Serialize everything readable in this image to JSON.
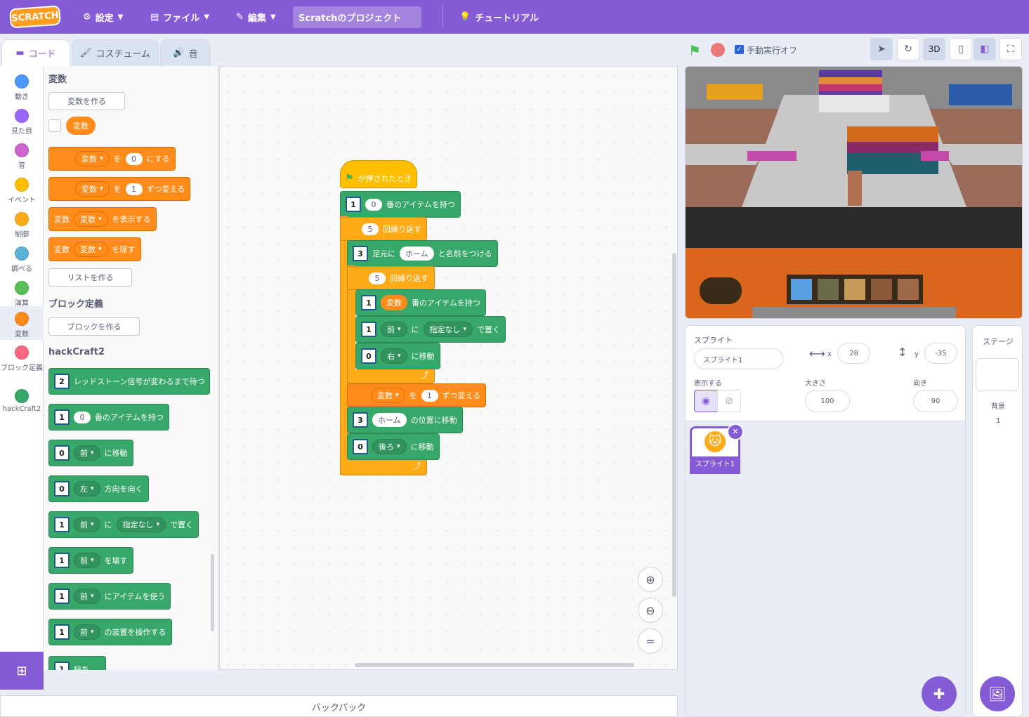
{
  "menubar": {
    "logo": "SCRATCH",
    "settings": "設定",
    "file": "ファイル",
    "edit": "編集",
    "project_title": "Scratchのプロジェクト",
    "tutorial": "チュートリアル"
  },
  "tabs": {
    "code": "コード",
    "costume": "コスチューム",
    "sound": "音"
  },
  "categories": [
    {
      "label": "動き",
      "color": "#4c97ff"
    },
    {
      "label": "見た目",
      "color": "#9966ff"
    },
    {
      "label": "音",
      "color": "#cf63cf"
    },
    {
      "label": "イベント",
      "color": "#ffbf00"
    },
    {
      "label": "制御",
      "color": "#ffab19"
    },
    {
      "label": "調べる",
      "color": "#5cb1d6"
    },
    {
      "label": "演算",
      "color": "#59c059"
    },
    {
      "label": "変数",
      "color": "#ff8c1a"
    },
    {
      "label": "ブロック定義",
      "color": "#ff6680"
    },
    {
      "label": "hackCraft2",
      "color": "#38a86a"
    }
  ],
  "flyout": {
    "variables_head": "変数",
    "make_var": "変数を作る",
    "var_name": "変数",
    "set_wo": "を",
    "set_val": "0",
    "set_suffix": "にする",
    "change_val": "1",
    "change_suffix": "ずつ変える",
    "show_suffix": "を表示する",
    "hide_suffix": "を隠す",
    "make_list": "リストを作る",
    "myblocks_head": "ブロック定義",
    "make_block": "ブロックを作る",
    "hc_head": "hackCraft2",
    "hc_wait": "レッドストーン信号が変わるまで待つ",
    "hc_hold_val": "0",
    "hc_hold": "番のアイテムを持つ",
    "front": "前",
    "left": "左",
    "move": "に移動",
    "face": "方向を向く",
    "ni": "に",
    "unspecified": "指定なし",
    "place": "で置く",
    "break": "を壊す",
    "use_item": "にアイテムを使う",
    "equip": "の装置を操作する",
    "cut": "持ち..."
  },
  "script": {
    "hat": "が押されたとき",
    "hold_val": "0",
    "hold": "番のアイテムを持つ",
    "repeat1": "5",
    "repeat_label": "回繰り返す",
    "name_prefix": "足元に",
    "name_val": "ホーム",
    "name_suffix": "と名前をつける",
    "repeat2": "5",
    "var": "変数",
    "front": "前",
    "ni": "に",
    "unspecified": "指定なし",
    "place": "で置く",
    "right": "右",
    "move": "に移動",
    "wo": "を",
    "change_val": "1",
    "change_suffix": "ずつ変える",
    "home": "ホーム",
    "goto": "の位置に移動",
    "back": "後ろ"
  },
  "stage_bar": {
    "turbo": "手動実行オフ",
    "threed": "3D"
  },
  "sprite": {
    "head": "スプライト",
    "name": "スプライト1",
    "x_label": "x",
    "x": "28",
    "y_label": "y",
    "y": "-35",
    "show_label": "表示する",
    "size_label": "大きさ",
    "size": "100",
    "dir_label": "向き",
    "direction": "90",
    "thumb_name": "スプライト1"
  },
  "stage_pane": {
    "head": "ステージ",
    "backdrop_label": "背景",
    "backdrop_count": "1"
  },
  "backpack": "バックパック"
}
